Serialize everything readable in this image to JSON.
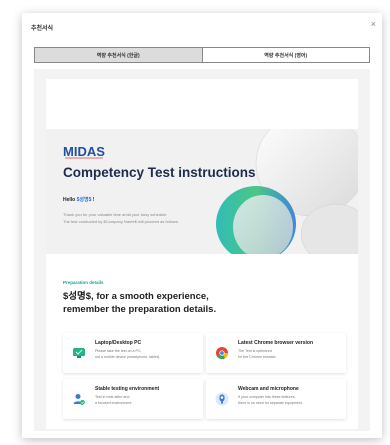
{
  "modal": {
    "title": "추천서식",
    "close_symbol": "×"
  },
  "tabs": [
    {
      "label": "역량 추천서식 (한글)",
      "active": true
    },
    {
      "label": "역량 추천서식 (영어)",
      "active": false
    }
  ],
  "document": {
    "logo_text": "MIDAS",
    "hero_title": "Competency Test instructions",
    "hello_prefix": "Hello ",
    "hello_variable": "$성명$",
    "hello_suffix": " !",
    "intro_line1": "Thank you for your valuable time amid your busy schedule.",
    "intro_line2": "The test conducted by $Company Name$ will proceed as follows.",
    "prep_label": "Preparation details",
    "prep_heading_line1": "$성명$, for a smooth experience,",
    "prep_heading_line2": "remember the preparation details.",
    "cards": [
      {
        "title": "Laptop/Desktop PC",
        "desc1": "Please take the test on a PC,",
        "desc2": "not a mobile device (smartphone, tablet).",
        "icon": "monitor-icon"
      },
      {
        "title": "Latest Chrome browser version",
        "desc1": "The Test is optimized",
        "desc2": "for the Chrome browser.",
        "icon": "chrome-icon"
      },
      {
        "title": "Stable testing environment",
        "desc1": "Test in neat attire and",
        "desc2": "a focused environment.",
        "icon": "person-check-icon"
      },
      {
        "title": "Webcam and microphone",
        "desc1": "If your computer has these features,",
        "desc2": "there is no need for separate equipment.",
        "icon": "webcam-icon"
      }
    ]
  },
  "colors": {
    "accent_green": "#1aa38f",
    "title_navy": "#1d2b4d",
    "variable_blue": "#2d73d6"
  }
}
